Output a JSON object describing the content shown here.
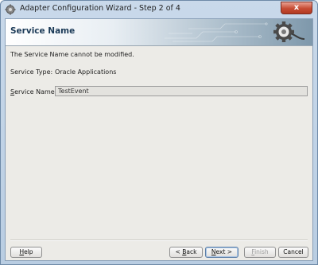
{
  "window": {
    "title": "Adapter Configuration Wizard - Step 2 of 4",
    "close_label": "x"
  },
  "banner": {
    "title": "Service Name"
  },
  "content": {
    "note": "The Service Name cannot be modified.",
    "service_type_label": "Service Type:",
    "service_type_value": "Oracle Applications",
    "service_name_label_prefix": "S",
    "service_name_label_rest": "ervice Name:",
    "service_name_value": "TestEvent"
  },
  "buttons": {
    "help_prefix": "H",
    "help_rest": "elp",
    "back_prefix": "< ",
    "back_mnemonic": "B",
    "back_rest": "ack",
    "next_mnemonic": "N",
    "next_rest": "ext >",
    "finish_mnemonic": "F",
    "finish_rest": "inish",
    "cancel": "Cancel"
  },
  "colors": {
    "banner_title": "#1b3a57",
    "title_bar": "#c9d9ea",
    "close_button": "#c74b33"
  }
}
